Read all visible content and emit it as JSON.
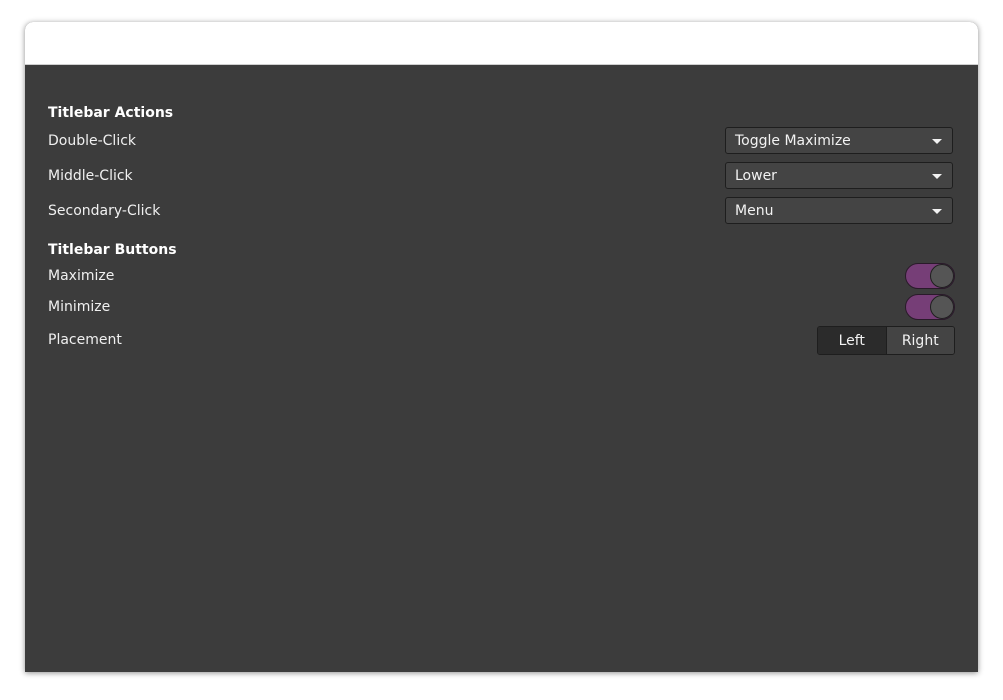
{
  "titlebar_actions": {
    "title": "Titlebar Actions",
    "rows": [
      {
        "label": "Double-Click",
        "value": "Toggle Maximize"
      },
      {
        "label": "Middle-Click",
        "value": "Lower"
      },
      {
        "label": "Secondary-Click",
        "value": "Menu"
      }
    ]
  },
  "titlebar_buttons": {
    "title": "Titlebar Buttons",
    "maximize": {
      "label": "Maximize",
      "enabled": true
    },
    "minimize": {
      "label": "Minimize",
      "enabled": true
    },
    "placement": {
      "label": "Placement",
      "options": [
        "Left",
        "Right"
      ],
      "selected": "Left"
    }
  },
  "colors": {
    "background": "#3c3c3c",
    "switch_on": "#763e77",
    "titlebar": "#ffffff"
  },
  "icons": {
    "dropdown": "chevron-down-icon"
  }
}
